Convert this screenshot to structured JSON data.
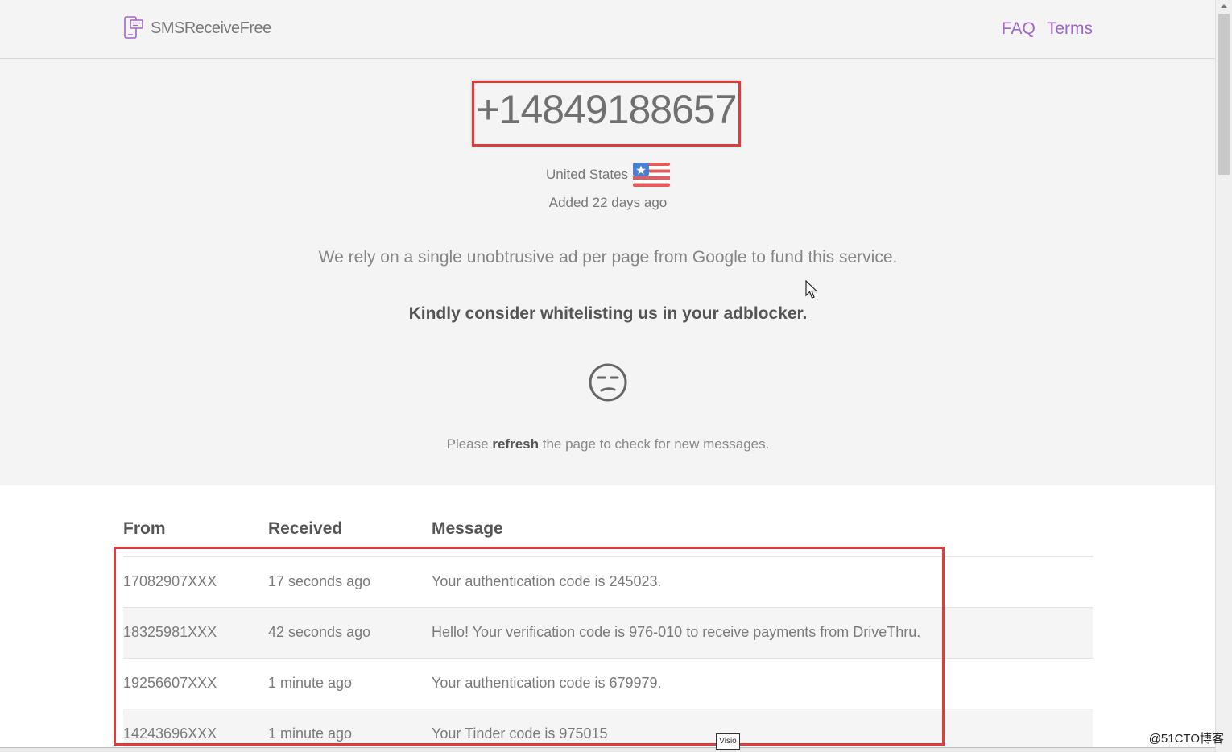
{
  "header": {
    "brand": "SMSReceiveFree",
    "nav": [
      {
        "label": "FAQ"
      },
      {
        "label": "Terms"
      }
    ]
  },
  "hero": {
    "phone_number": "+14849188657",
    "country": "United States",
    "added": "Added 22 days ago",
    "ad_notice": "We rely on a single unobtrusive ad per page from Google to fund this service.",
    "whitelist_request": "Kindly consider whitelisting us in your adblocker.",
    "refresh_prefix": "Please",
    "refresh_word": "refresh",
    "refresh_suffix": "the page to check for new messages."
  },
  "table": {
    "headers": [
      "From",
      "Received",
      "Message"
    ],
    "rows": [
      {
        "from": "17082907XXX",
        "received": "17 seconds ago",
        "message": "Your authentication code is 245023."
      },
      {
        "from": "18325981XXX",
        "received": "42 seconds ago",
        "message": "Hello! Your verification code is 976-010 to receive payments from DriveThru."
      },
      {
        "from": "19256607XXX",
        "received": "1 minute ago",
        "message": "Your authentication code is 679979."
      },
      {
        "from": "14243696XXX",
        "received": "1 minute ago",
        "message": "Your Tinder code is 975015"
      }
    ]
  },
  "overlay": {
    "visio_label": "Visio",
    "watermark": "@51CTO博客"
  },
  "colors": {
    "accent": "#a067c8",
    "highlight_border": "#de3b3b",
    "page_bg": "#f4f4f5"
  },
  "icons": {
    "brand": "phone-chat-icon",
    "flag": "us-flag-icon",
    "face": "unamused-face-icon"
  }
}
